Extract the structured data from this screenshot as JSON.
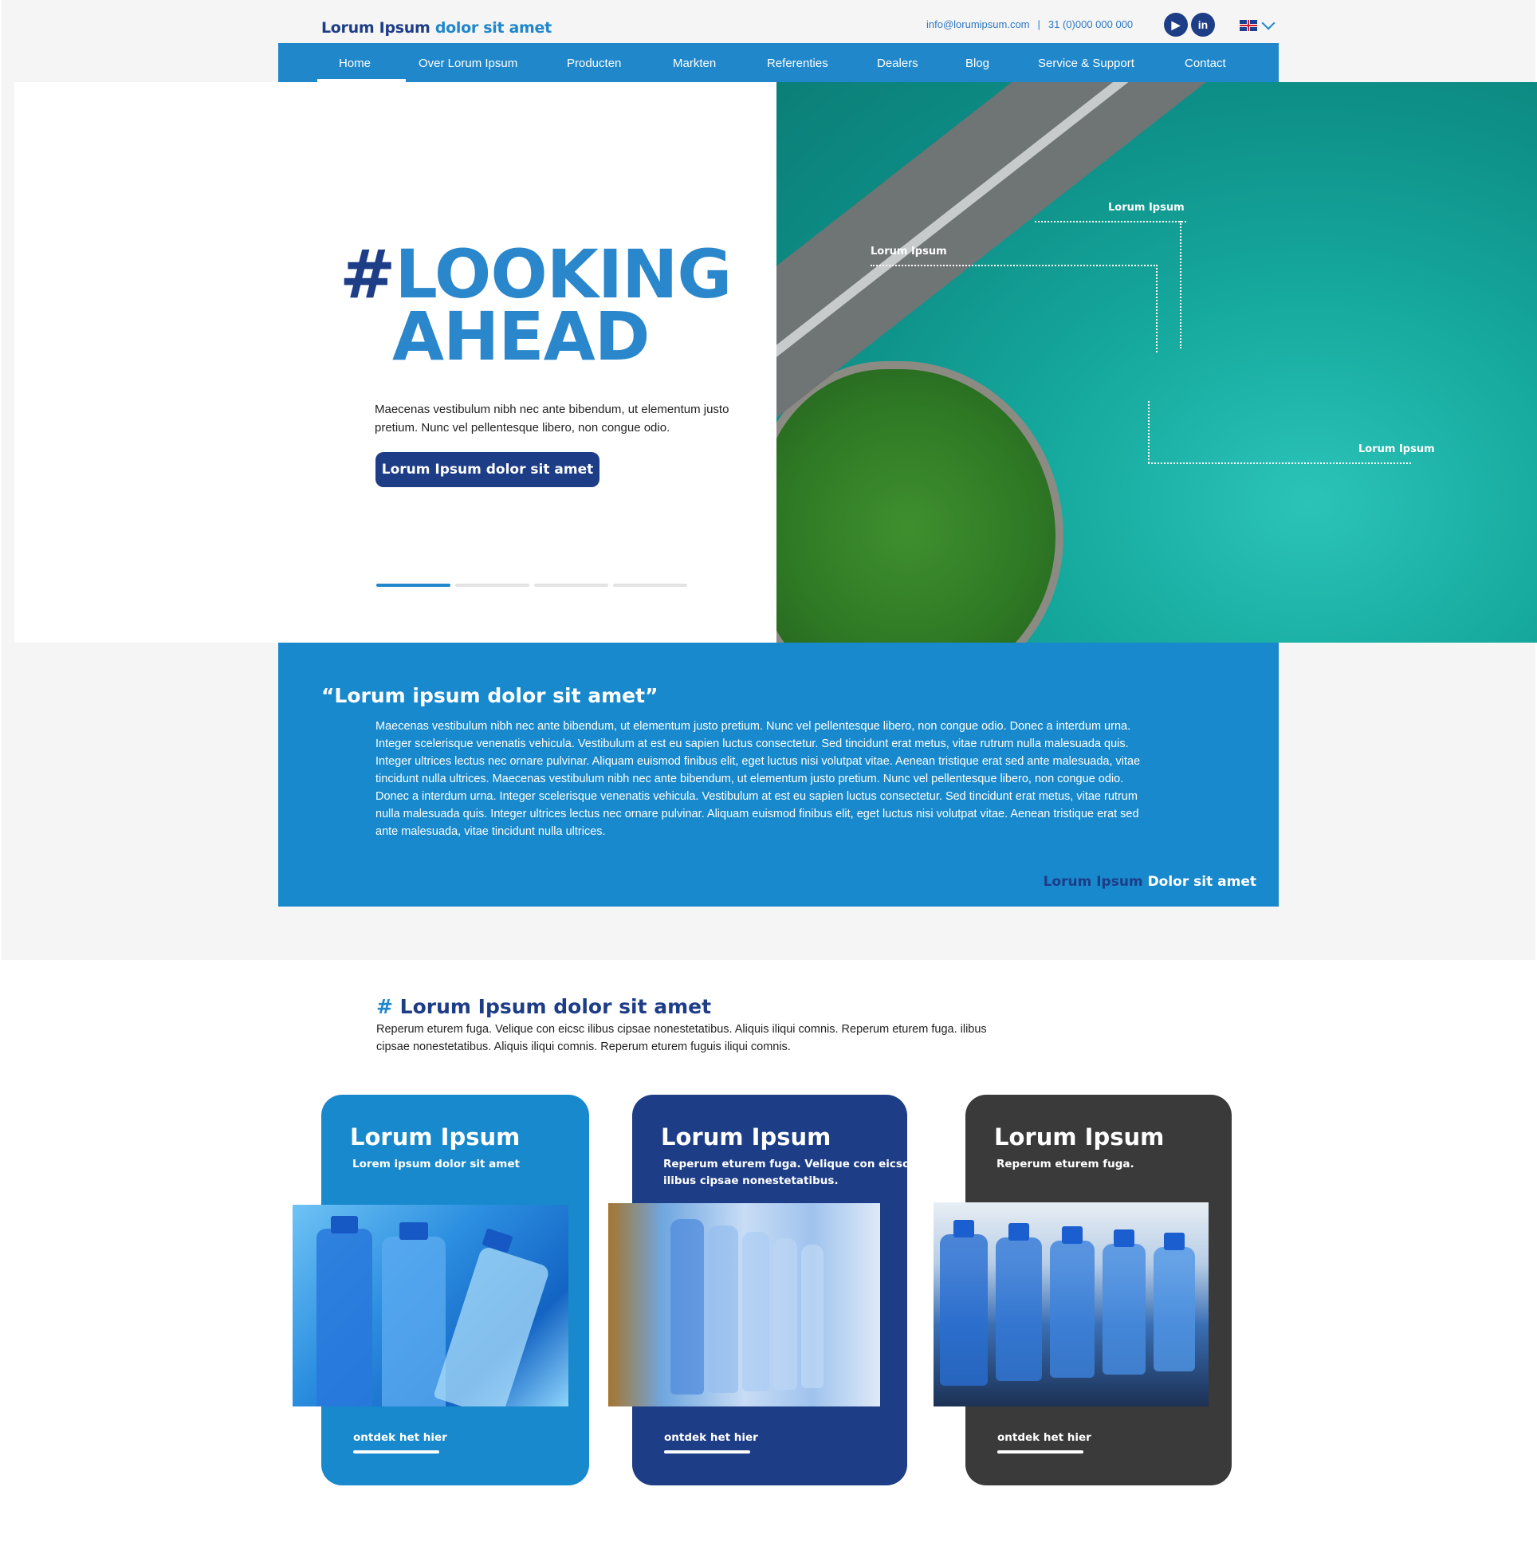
{
  "header": {
    "logo_part1": "Lorum Ipsum",
    "logo_part2": "dolor sit amet",
    "email": "info@lorumipsum.com",
    "separator": "|",
    "phone": "31 (0)000 000 000",
    "social": [
      "youtube-icon",
      "linkedin-icon"
    ],
    "social_labels": [
      "▶",
      "in"
    ],
    "language_flag": "uk-flag-icon"
  },
  "nav": {
    "items": [
      "Home",
      "Over Lorum Ipsum",
      "Producten",
      "Markten",
      "Referenties",
      "Dealers",
      "Blog",
      "Service & Support",
      "Contact"
    ],
    "active": "Home"
  },
  "hero": {
    "hash": "#",
    "line1": "LOOKING",
    "line2": "AHEAD",
    "text": "Maecenas vestibulum nibh nec ante bibendum, ut elementum justo pretium. Nunc vel pellentesque libero, non congue odio.",
    "button": "Lorum Ipsum dolor sit amet",
    "slides": 4,
    "active_slide": 1,
    "callouts": [
      "Lorum Ipsum",
      "Lorum Ipsum",
      "Lorum Ipsum"
    ]
  },
  "quote": {
    "title": "“Lorum ipsum dolor sit amet”",
    "body": "Maecenas vestibulum nibh nec ante bibendum, ut elementum justo pretium. Nunc vel pellentesque libero, non congue odio. Donec a interdum urna. Integer scelerisque venenatis vehicula. Vestibulum at est eu sapien luctus consectetur. Sed tincidunt erat metus, vitae rutrum nulla malesuada quis. Integer ultrices lectus nec ornare pulvinar. Aliquam euismod finibus elit, eget luctus nisi volutpat vitae. Aenean tristique erat sed ante malesuada, vitae tincidunt nulla ultrices. Maecenas vestibulum nibh nec ante bibendum, ut elementum justo pretium. Nunc vel pellentesque libero, non congue odio. Donec a interdum urna. Integer scelerisque venenatis vehicula. Vestibulum at est eu sapien luctus consectetur. Sed tincidunt erat metus, vitae rutrum nulla malesuada quis. Integer ultrices lectus nec ornare pulvinar. Aliquam euismod finibus elit, eget luctus nisi volutpat vitae. Aenean tristique erat sed ante malesuada, vitae tincidunt nulla ultrices.",
    "signature_part1": "Lorum Ipsum",
    "signature_part2": "Dolor sit amet"
  },
  "section2": {
    "hash": "#",
    "title": "Lorum Ipsum dolor sit amet",
    "text": "Reperum eturem fuga. Velique con eicsc ilibus cipsae nonestetatibus. Aliquis iliqui comnis. Reperum eturem fuga. ilibus cipsae nonestetatibus. Aliquis iliqui comnis. Reperum eturem fuguis iliqui comnis."
  },
  "cards": [
    {
      "title": "Lorum Ipsum",
      "subtitle": "Lorem ipsum dolor sit amet",
      "link": "ontdek het hier",
      "color": "#1789cc"
    },
    {
      "title": "Lorum Ipsum",
      "subtitle": "Reperum eturem fuga. Velique con eicsc ilibus cipsae nonestetatibus.",
      "link": "ontdek het hier",
      "color": "#1d3d87"
    },
    {
      "title": "Lorum Ipsum",
      "subtitle": "Reperum eturem fuga.",
      "link": "ontdek het hier",
      "color": "#3a3a3a"
    }
  ],
  "colors": {
    "primary_blue": "#1f87ca",
    "dark_blue": "#1d3d87",
    "dark_gray": "#3a3a3a",
    "background": "#f5f5f5"
  }
}
